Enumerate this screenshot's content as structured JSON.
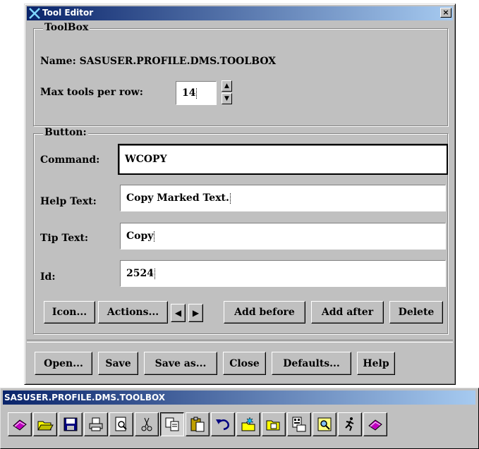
{
  "window": {
    "title": "Tool Editor",
    "close_glyph": "×"
  },
  "toolbox_group": {
    "legend": "ToolBox",
    "name_label": "Name: SASUSER.PROFILE.DMS.TOOLBOX",
    "max_tools_label": "Max tools per row:",
    "max_tools_value": "14",
    "spin_up": "▲",
    "spin_down": "▼"
  },
  "button_group": {
    "legend": "Button:",
    "command_label": "Command:",
    "command_value": "WCOPY",
    "help_label": "Help Text:",
    "help_value": "Copy Marked Text.",
    "tip_label": "Tip Text:",
    "tip_value": "Copy",
    "id_label": "Id:",
    "id_value": "2524",
    "buttons": {
      "icon": "Icon...",
      "actions": "Actions...",
      "prev": "◀",
      "next": "▶",
      "add_before": "Add before",
      "add_after": "Add after",
      "delete": "Delete"
    }
  },
  "bottom_buttons": {
    "open": "Open...",
    "save": "Save",
    "save_as": "Save as...",
    "close": "Close",
    "defaults": "Defaults...",
    "help": "Help"
  },
  "toolbox_window": {
    "title": "SASUSER.PROFILE.DMS.TOOLBOX",
    "tools": [
      "book-icon",
      "open-folder-icon",
      "save-icon",
      "print-icon",
      "print-preview-icon",
      "cut-icon",
      "copy-icon",
      "paste-icon",
      "undo-icon",
      "new-folder-icon",
      "open-folder-alt-icon",
      "explorer-icon",
      "find-icon",
      "run-icon",
      "book-icon"
    ]
  }
}
